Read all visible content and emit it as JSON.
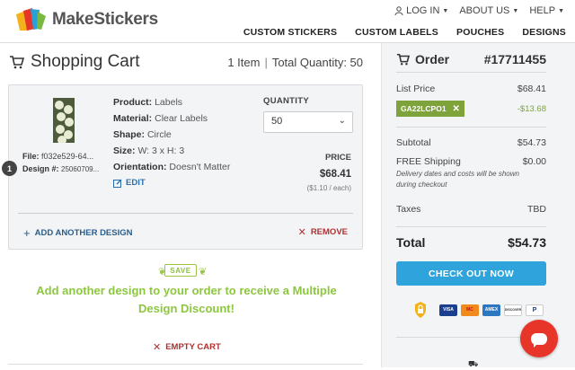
{
  "brand": {
    "name": "MakeStickers"
  },
  "top_links": [
    {
      "label": "LOG IN",
      "icon": "user-icon"
    },
    {
      "label": "ABOUT US"
    },
    {
      "label": "HELP"
    }
  ],
  "nav": [
    "CUSTOM STICKERS",
    "CUSTOM LABELS",
    "POUCHES",
    "DESIGNS"
  ],
  "cart": {
    "title": "Shopping Cart",
    "item_count": "1 Item",
    "separator": "|",
    "total_quantity": "Total Quantity: 50"
  },
  "item": {
    "number": "1",
    "file_label": "File:",
    "file_value": "f032e529-64...",
    "design_label": "Design #:",
    "design_value": "25060709...",
    "product_label": "Product:",
    "product_value": "Labels",
    "material_label": "Material:",
    "material_value": "Clear Labels",
    "shape_label": "Shape:",
    "shape_value": "Circle",
    "size_label": "Size:",
    "size_value": "W: 3 x H: 3",
    "orientation_label": "Orientation:",
    "orientation_value": "Doesn't Matter",
    "edit_label": "EDIT",
    "quantity_label": "QUANTITY",
    "quantity_value": "50",
    "price_label": "PRICE",
    "price_value": "$68.41",
    "price_each": "($1.10 / each)",
    "add_design_label": "ADD ANOTHER DESIGN",
    "remove_label": "REMOVE"
  },
  "promo": {
    "save_badge": "SAVE",
    "text": "Add another design to your order to receive a Multiple Design Discount!"
  },
  "empty_cart_label": "EMPTY CART",
  "order": {
    "title": "Order",
    "number": "#17711455",
    "list_price_label": "List Price",
    "list_price_value": "$68.41",
    "coupon_code": "GA22LCPO1",
    "coupon_value": "-$13.68",
    "subtotal_label": "Subtotal",
    "subtotal_value": "$54.73",
    "shipping_label": "FREE Shipping",
    "shipping_value": "$0.00",
    "shipping_note": "Delivery dates and costs will be shown during checkout",
    "taxes_label": "Taxes",
    "taxes_value": "TBD",
    "total_label": "Total",
    "total_value": "$54.73",
    "checkout_label": "CHECK OUT NOW",
    "payment_methods": [
      "VISA",
      "MC",
      "AMEX",
      "DISCOVER",
      "P"
    ]
  },
  "colors": {
    "accent_blue": "#2ea3dc",
    "promo_green": "#8dc63f",
    "coupon_green": "#7ea33b",
    "remove_red": "#b03030",
    "chat_red": "#e8352a"
  }
}
